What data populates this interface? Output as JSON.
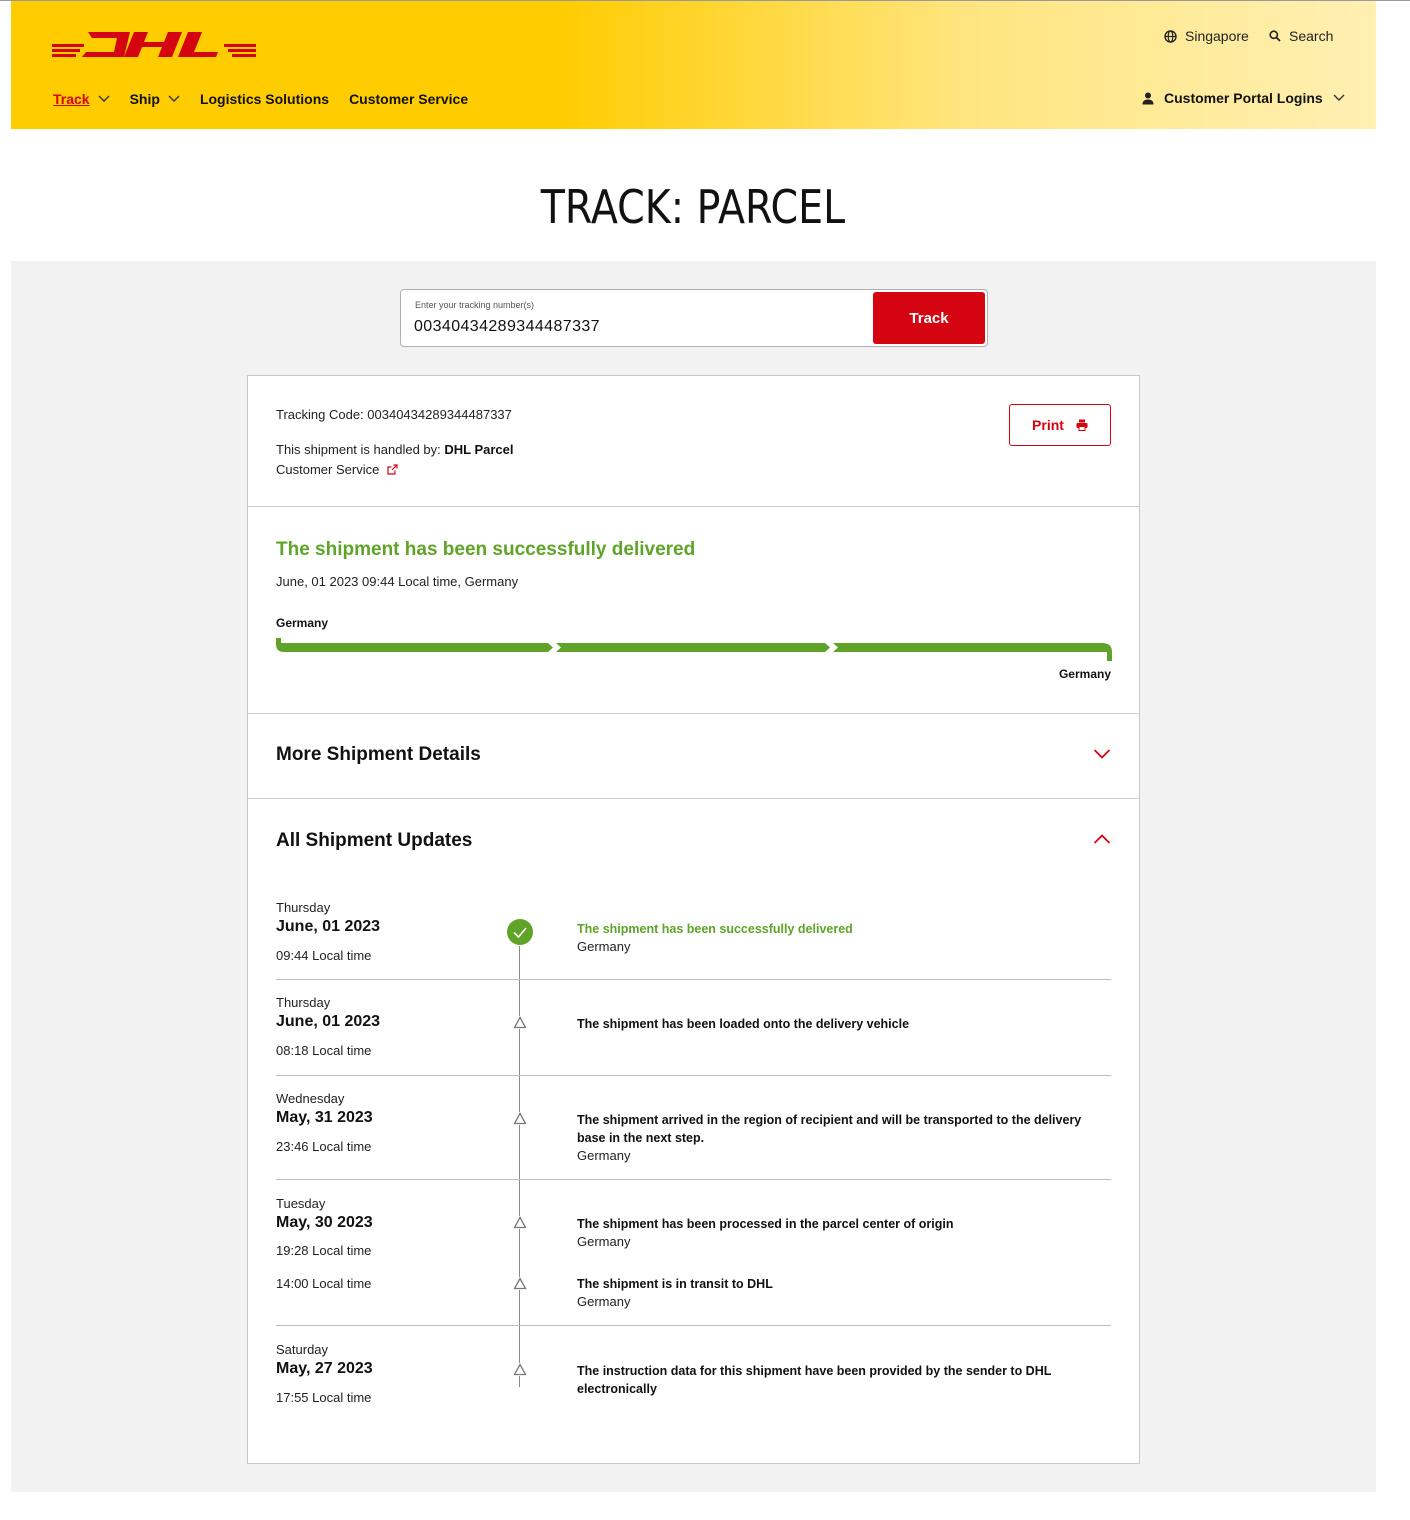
{
  "header": {
    "region": "Singapore",
    "search": "Search",
    "nav": [
      {
        "label": "Track"
      },
      {
        "label": "Ship"
      },
      {
        "label": "Logistics Solutions"
      },
      {
        "label": "Customer Service"
      }
    ],
    "portal": "Customer Portal Logins"
  },
  "page": {
    "title": "TRACK: PARCEL"
  },
  "search_form": {
    "placeholder": "Enter your tracking number(s)",
    "value": "00340434289344487337",
    "button": "Track"
  },
  "summary": {
    "tracking_code": "Tracking Code: 00340434289344487337",
    "handled_prefix": "This shipment is handled by: ",
    "handled_by": "DHL Parcel",
    "customer_service": "Customer Service",
    "print": "Print"
  },
  "status": {
    "title": "The shipment has been successfully delivered",
    "date": "June, 01 2023 09:44 Local time, Germany",
    "origin": "Germany",
    "destination": "Germany"
  },
  "more_details": {
    "title": "More Shipment Details"
  },
  "updates": {
    "title": "All Shipment Updates",
    "groups": [
      {
        "day": "Thursday",
        "date": "June, 01 2023",
        "events": [
          {
            "time": "09:44 Local time",
            "text": "The shipment has been successfully delivered",
            "location": "Germany"
          }
        ]
      },
      {
        "day": "Thursday",
        "date": "June, 01 2023",
        "events": [
          {
            "time": "08:18 Local time",
            "text": "The shipment has been loaded onto the delivery vehicle",
            "location": ""
          }
        ]
      },
      {
        "day": "Wednesday",
        "date": "May, 31 2023",
        "events": [
          {
            "time": "23:46 Local time",
            "text": "The shipment arrived in the region of recipient and will be transported to the delivery base in the next step.",
            "location": "Germany"
          }
        ]
      },
      {
        "day": "Tuesday",
        "date": "May, 30 2023",
        "events": [
          {
            "time": "19:28 Local time",
            "text": "The shipment has been processed in the parcel center of origin",
            "location": "Germany"
          },
          {
            "time": "14:00 Local time",
            "text": "The shipment is in transit to DHL",
            "location": "Germany"
          }
        ]
      },
      {
        "day": "Saturday",
        "date": "May, 27 2023",
        "events": [
          {
            "time": "17:55 Local time",
            "text": "The instruction data for this shipment have been provided by the sender to DHL electronically",
            "location": ""
          }
        ]
      }
    ]
  },
  "colors": {
    "brand_yellow": "#ffcc00",
    "brand_red": "#d40511",
    "success_green": "#5fa329"
  }
}
